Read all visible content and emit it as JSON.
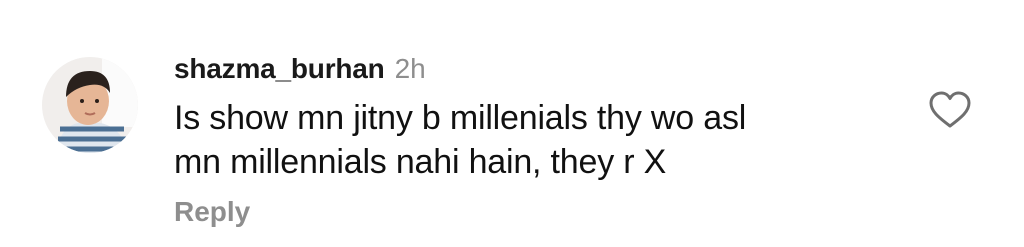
{
  "comment": {
    "username": "shazma_burhan",
    "time": "2h",
    "text_lines": [
      "Is show mn jitny b millenials thy wo asl",
      "mn millennials nahi hain, they r X"
    ],
    "reply_label": "Reply"
  },
  "icons": {
    "like": "heart-outline-icon",
    "avatar": "profile-photo"
  },
  "colors": {
    "muted_text": "#8e8e8e",
    "primary_text": "#111111"
  }
}
